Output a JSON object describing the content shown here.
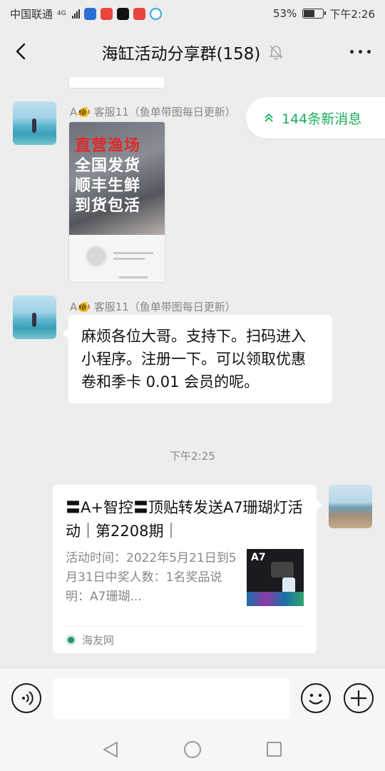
{
  "status_bar": {
    "carrier": "中国联通",
    "network": "4G",
    "battery": "53%",
    "battery_level": 0.53,
    "time": "下午2:26"
  },
  "header": {
    "title": "海缸活动分享群(158)",
    "icons": [
      "back-arrow-icon",
      "mute-bell-icon",
      "more-icon"
    ]
  },
  "new_messages_pill": {
    "label": "144条新消息",
    "icon": "double-chevron-up-icon",
    "color": "#1aad5a"
  },
  "messages": [
    {
      "type": "image",
      "sender": "A🐠 客服11（鱼单带图每日更新）",
      "image_text": [
        "直营渔场",
        "全国发货",
        "顺丰生鲜",
        "到货包活"
      ]
    },
    {
      "type": "text",
      "sender": "A🐠 客服11（鱼单带图每日更新）",
      "text": "麻烦各位大哥。支持下。扫码进入小程序。注册一下。可以领取优惠卷和季卡 0.01 会员的呢。"
    },
    {
      "type": "time",
      "text": "下午2:25"
    },
    {
      "type": "link",
      "title": "〓A+智控〓顶贴转发送A7珊瑚灯活动｜第2208期｜",
      "description": "活动时间：2022年5月21日到5月31日中奖人数：1名奖品说明：A7珊瑚...",
      "thumb_label": "A7",
      "source": "海友网"
    }
  ],
  "input_bar": {
    "icons": [
      "voice-icon",
      "emoji-icon",
      "plus-icon"
    ]
  },
  "nav_bar": {
    "icons": [
      "nav-back-icon",
      "nav-home-icon",
      "nav-recent-icon"
    ]
  }
}
